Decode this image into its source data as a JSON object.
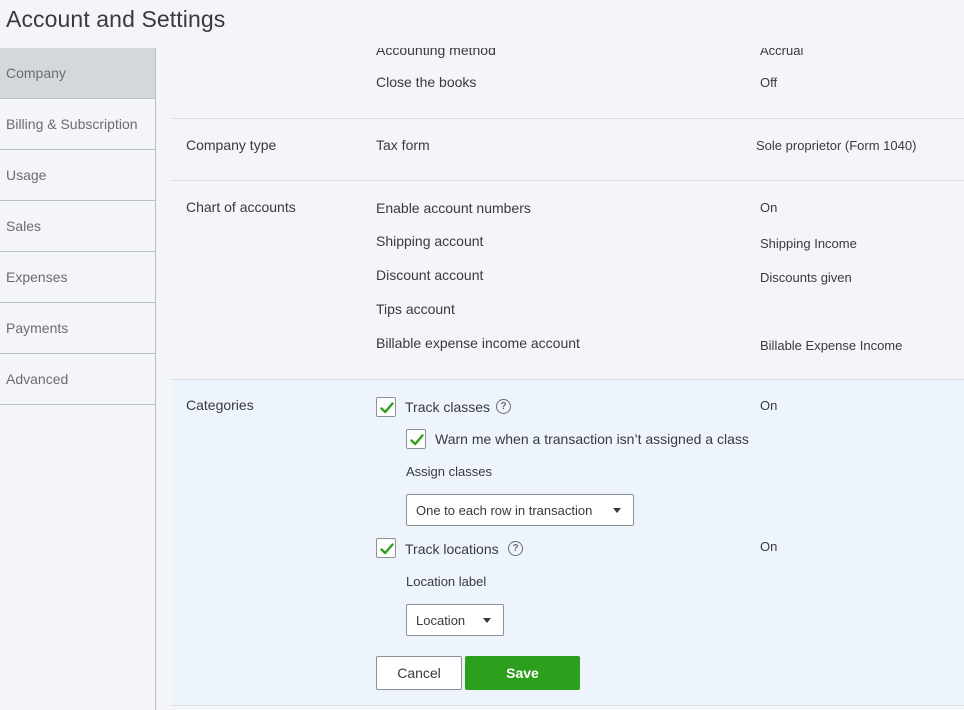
{
  "app": {
    "title": "Account and Settings"
  },
  "sidebar": {
    "items": [
      {
        "label": "Company",
        "active": true
      },
      {
        "label": "Billing & Subscription"
      },
      {
        "label": "Usage"
      },
      {
        "label": "Sales"
      },
      {
        "label": "Expenses"
      },
      {
        "label": "Payments"
      },
      {
        "label": "Advanced"
      }
    ]
  },
  "accounting": {
    "method_label": "Accounting method",
    "method_value": "Accrual",
    "close_books_label": "Close the books",
    "close_books_value": "Off"
  },
  "company_type": {
    "section_label": "Company type",
    "tax_form_label": "Tax form",
    "tax_form_value": "Sole proprietor (Form 1040)"
  },
  "chart_of_accounts": {
    "section_label": "Chart of accounts",
    "rows": [
      {
        "label": "Enable account numbers",
        "value": "On"
      },
      {
        "label": "Shipping account",
        "value": "Shipping Income"
      },
      {
        "label": "Discount account",
        "value": "Discounts given"
      },
      {
        "label": "Tips account",
        "value": ""
      },
      {
        "label": "Billable expense income account",
        "value": "Billable Expense Income"
      }
    ]
  },
  "categories": {
    "section_label": "Categories",
    "track_classes": {
      "label": "Track classes",
      "checked": true,
      "value": "On"
    },
    "warn_class": {
      "label": "Warn me when a transaction isn’t assigned a class",
      "checked": true
    },
    "assign_classes": {
      "label": "Assign classes",
      "selected": "One to each row in transaction"
    },
    "track_locations": {
      "label": "Track locations",
      "checked": true,
      "value": "On"
    },
    "location_label": {
      "label": "Location label",
      "selected": "Location"
    },
    "help_symbol": "?"
  },
  "buttons": {
    "cancel": "Cancel",
    "save": "Save"
  },
  "colors": {
    "accent_green": "#2ca01c",
    "active_sidebar": "#d4d7dc",
    "categories_bg": "#eef4fb"
  }
}
